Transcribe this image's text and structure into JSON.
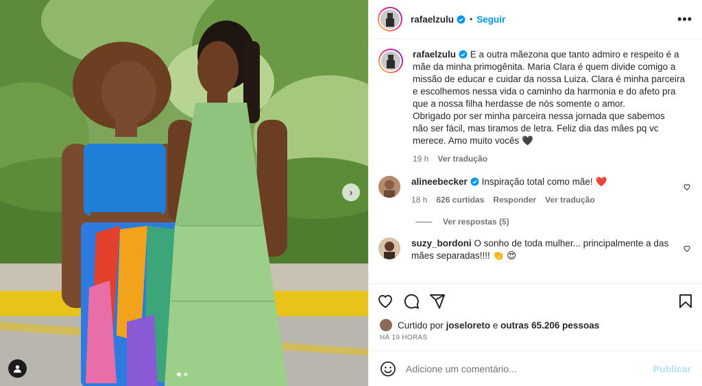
{
  "post": {
    "author": "rafaelzulu",
    "follow_label": "Seguir",
    "separator": "•",
    "more_label": "•••"
  },
  "caption": {
    "username": "rafaelzulu",
    "lines": [
      "E a outra mãezona que tanto admiro e respeito é a",
      "mãe da minha primogênita. Maria Clara é quem divide comigo a",
      "missão de educar e cuidar da nossa Luiza. Clara é minha parceira",
      "e escolhemos nessa vida o caminho da harmonia e do afeto pra",
      "que a nossa filha herdasse de nós somente o amor.",
      "Obrigado por ser minha parceira nessa jornada que sabemos",
      "não ser fácil, mas tiramos de letra. Feliz dia das mães pq vc",
      "merece. Amo muito vocês"
    ],
    "emoji": "🖤",
    "time": "19 h",
    "translate_label": "Ver tradução"
  },
  "comments": [
    {
      "username": "alineebecker",
      "text": "Inspiração total como mãe!",
      "emoji": "❤️",
      "time": "18 h",
      "likes": "626 curtidas",
      "reply_label": "Responder",
      "translate_label": "Ver tradução",
      "replies_label": "Ver respostas (5)"
    },
    {
      "username": "suzy_bordoni",
      "text_line1": "O sonho de toda mulher... principalmente a das",
      "text_line2": "mães separadas!!!!",
      "emoji": "👏 😍"
    }
  ],
  "likes_bar": {
    "prefix": "Curtido por",
    "user": "joseloreto",
    "conj": "e",
    "others": "outras 65.206 pessoas"
  },
  "timestamp": "HÁ 19 HORAS",
  "add_comment": {
    "placeholder": "Adicione um comentário...",
    "publish_label": "Publicar"
  },
  "carousel": {
    "slides": 2,
    "active": 1
  },
  "colors": {
    "accent": "#0095f6",
    "publish_disabled": "#b2dffc",
    "muted": "#737373",
    "heart": "#ed4956"
  },
  "icons": [
    "verified-icon",
    "heart-icon",
    "comment-icon",
    "share-icon",
    "save-icon",
    "emoji-icon",
    "user-tag-icon",
    "chevron-right-icon",
    "more-options-icon"
  ]
}
